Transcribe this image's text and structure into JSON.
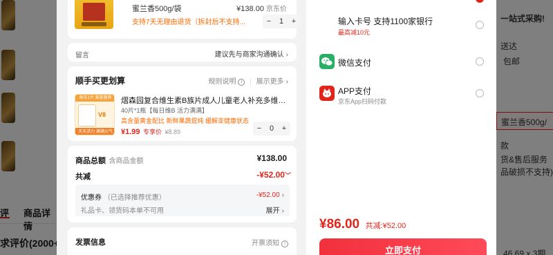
{
  "background": {
    "tabs": [
      "评",
      "商品详情"
    ],
    "eval_text": "求评价(2000+",
    "right_texts": [
      "一站式采购!",
      "送达",
      "包邮",
      "蜜兰香500g/",
      "款",
      "货&售后服务",
      "品破损不支持)",
      "46.69 x 3期"
    ]
  },
  "product": {
    "name": "蜜兰香500g/袋",
    "price": "¥138.00",
    "price_suffix": "京东价",
    "notice": "支持7天无理由退货（拆封后不支持...",
    "qty": "1"
  },
  "message": {
    "label": "留言",
    "hint": "建议先与商家沟通确认"
  },
  "addon": {
    "title": "顺手买更划算",
    "rules": "规则说明",
    "more": "展示更多",
    "item_name": "熠森园复合维生素B族片成人儿童老人补充多维b1b...",
    "item_spec": "40片*1瓶【每日维B 活力满满】",
    "item_slogan": "高含量黄金配比 新鲜果蔬提纯 缓解亚健康状态",
    "item_price": "¥1.99",
    "item_price_tag": "专享价",
    "item_orig_price": "¥8.89",
    "item_qty": "0",
    "item_img_top": "每天1片 美容营养",
    "item_img_v": "V8",
    "item_img_bottom": "天天活力 满满元气"
  },
  "summary": {
    "total_label": "商品总额",
    "total_note": "含商品金额",
    "total_value": "¥138.00",
    "discount_label": "共减",
    "discount_value": "-¥52.00",
    "coupon_label": "优惠券",
    "coupon_note": "（已选择推荐优惠）",
    "coupon_value": "-¥52.00",
    "giftcard_label": "礼品卡、领货码本单不可用",
    "expand": "展开"
  },
  "invoice": {
    "label": "发票信息",
    "note": "开票须知"
  },
  "payment": {
    "card_title": "输入卡号 支持1100家银行",
    "card_promo": "最高减10元",
    "wechat_label": "微信支付",
    "app_label": "APP支付",
    "app_sub": "京东App扫码付款",
    "total": "¥86.00",
    "saved": "共减:¥52.00",
    "pay_button": "立即支付"
  },
  "colors": {
    "accent": "#e1251b",
    "wechat": "#2aae67",
    "pay_button": "#f2303d"
  }
}
